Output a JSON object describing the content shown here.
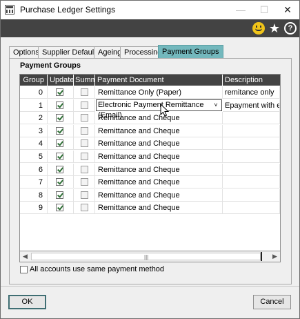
{
  "window": {
    "title": "Purchase Ledger Settings"
  },
  "toolbar": {
    "icons": [
      "smiley-icon",
      "star-icon",
      "help-icon"
    ]
  },
  "tabs": [
    {
      "label": "Options",
      "active": false
    },
    {
      "label": "Supplier Defaults",
      "active": false
    },
    {
      "label": "Ageing",
      "active": false
    },
    {
      "label": "Processing",
      "active": false
    },
    {
      "label": "Payment Groups",
      "active": true
    }
  ],
  "payment_groups": {
    "heading": "Payment Groups",
    "columns": [
      "Group",
      "Update",
      "Summary",
      "Payment Document",
      "Description"
    ],
    "rows": [
      {
        "group": "0",
        "update": true,
        "summary": false,
        "document": "Remittance Only (Paper)",
        "description": "remitance only"
      },
      {
        "group": "1",
        "update": true,
        "summary": false,
        "document": "Electronic Payment Remittance (Email)",
        "description": "Epayment with em",
        "editing": true
      },
      {
        "group": "2",
        "update": true,
        "summary": false,
        "document": "Remittance and Cheque",
        "description": ""
      },
      {
        "group": "3",
        "update": true,
        "summary": false,
        "document": "Remittance and Cheque",
        "description": ""
      },
      {
        "group": "4",
        "update": true,
        "summary": false,
        "document": "Remittance and Cheque",
        "description": ""
      },
      {
        "group": "5",
        "update": true,
        "summary": false,
        "document": "Remittance and Cheque",
        "description": ""
      },
      {
        "group": "6",
        "update": true,
        "summary": false,
        "document": "Remittance and Cheque",
        "description": ""
      },
      {
        "group": "7",
        "update": true,
        "summary": false,
        "document": "Remittance and Cheque",
        "description": ""
      },
      {
        "group": "8",
        "update": true,
        "summary": false,
        "document": "Remittance and Cheque",
        "description": ""
      },
      {
        "group": "9",
        "update": true,
        "summary": false,
        "document": "Remittance and Cheque",
        "description": ""
      }
    ],
    "all_accounts_label": "All accounts use same payment method",
    "all_accounts_checked": false
  },
  "buttons": {
    "ok": "OK",
    "cancel": "Cancel"
  },
  "colors": {
    "active_tab": "#73b8bd",
    "toolbar": "#434343",
    "header": "#434343",
    "ok_border": "#3f6e73"
  }
}
